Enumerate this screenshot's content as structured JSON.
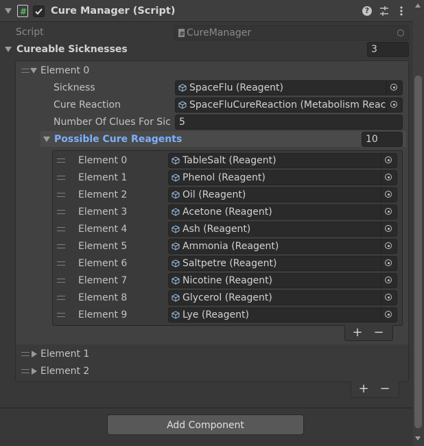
{
  "header": {
    "title": "Cure Manager (Script)",
    "enabled": true
  },
  "script_field": {
    "label": "Script",
    "value": "CureManager"
  },
  "cureable": {
    "label": "Cureable Sicknesses",
    "size": "3",
    "element0": {
      "label": "Element 0",
      "sickness_label": "Sickness",
      "sickness_value": "SpaceFlu (Reagent)",
      "cure_reaction_label": "Cure Reaction",
      "cure_reaction_value": "SpaceFluCureReaction (Metabolism Reac",
      "clues_label": "Number Of Clues For Sic",
      "clues_value": "5",
      "possible": {
        "label": "Possible Cure Reagents",
        "size": "10",
        "items": [
          {
            "label": "Element 0",
            "value": "TableSalt (Reagent)"
          },
          {
            "label": "Element 1",
            "value": "Phenol (Reagent)"
          },
          {
            "label": "Element 2",
            "value": "Oil (Reagent)"
          },
          {
            "label": "Element 3",
            "value": "Acetone (Reagent)"
          },
          {
            "label": "Element 4",
            "value": "Ash (Reagent)"
          },
          {
            "label": "Element 5",
            "value": "Ammonia (Reagent)"
          },
          {
            "label": "Element 6",
            "value": "Saltpetre (Reagent)"
          },
          {
            "label": "Element 7",
            "value": "Nicotine (Reagent)"
          },
          {
            "label": "Element 8",
            "value": "Glycerol (Reagent)"
          },
          {
            "label": "Element 9",
            "value": "Lye (Reagent)"
          }
        ]
      }
    },
    "element1": {
      "label": "Element 1"
    },
    "element2": {
      "label": "Element 2"
    }
  },
  "list_buttons": {
    "add": "+",
    "remove": "−"
  },
  "add_component": {
    "label": "Add Component"
  },
  "colors": {
    "background": "#383838",
    "header_bg": "#3e3e3e",
    "field_bg": "#2a2a2a",
    "highlight_text": "#7cb0ff",
    "highlight_row": "#454545"
  }
}
